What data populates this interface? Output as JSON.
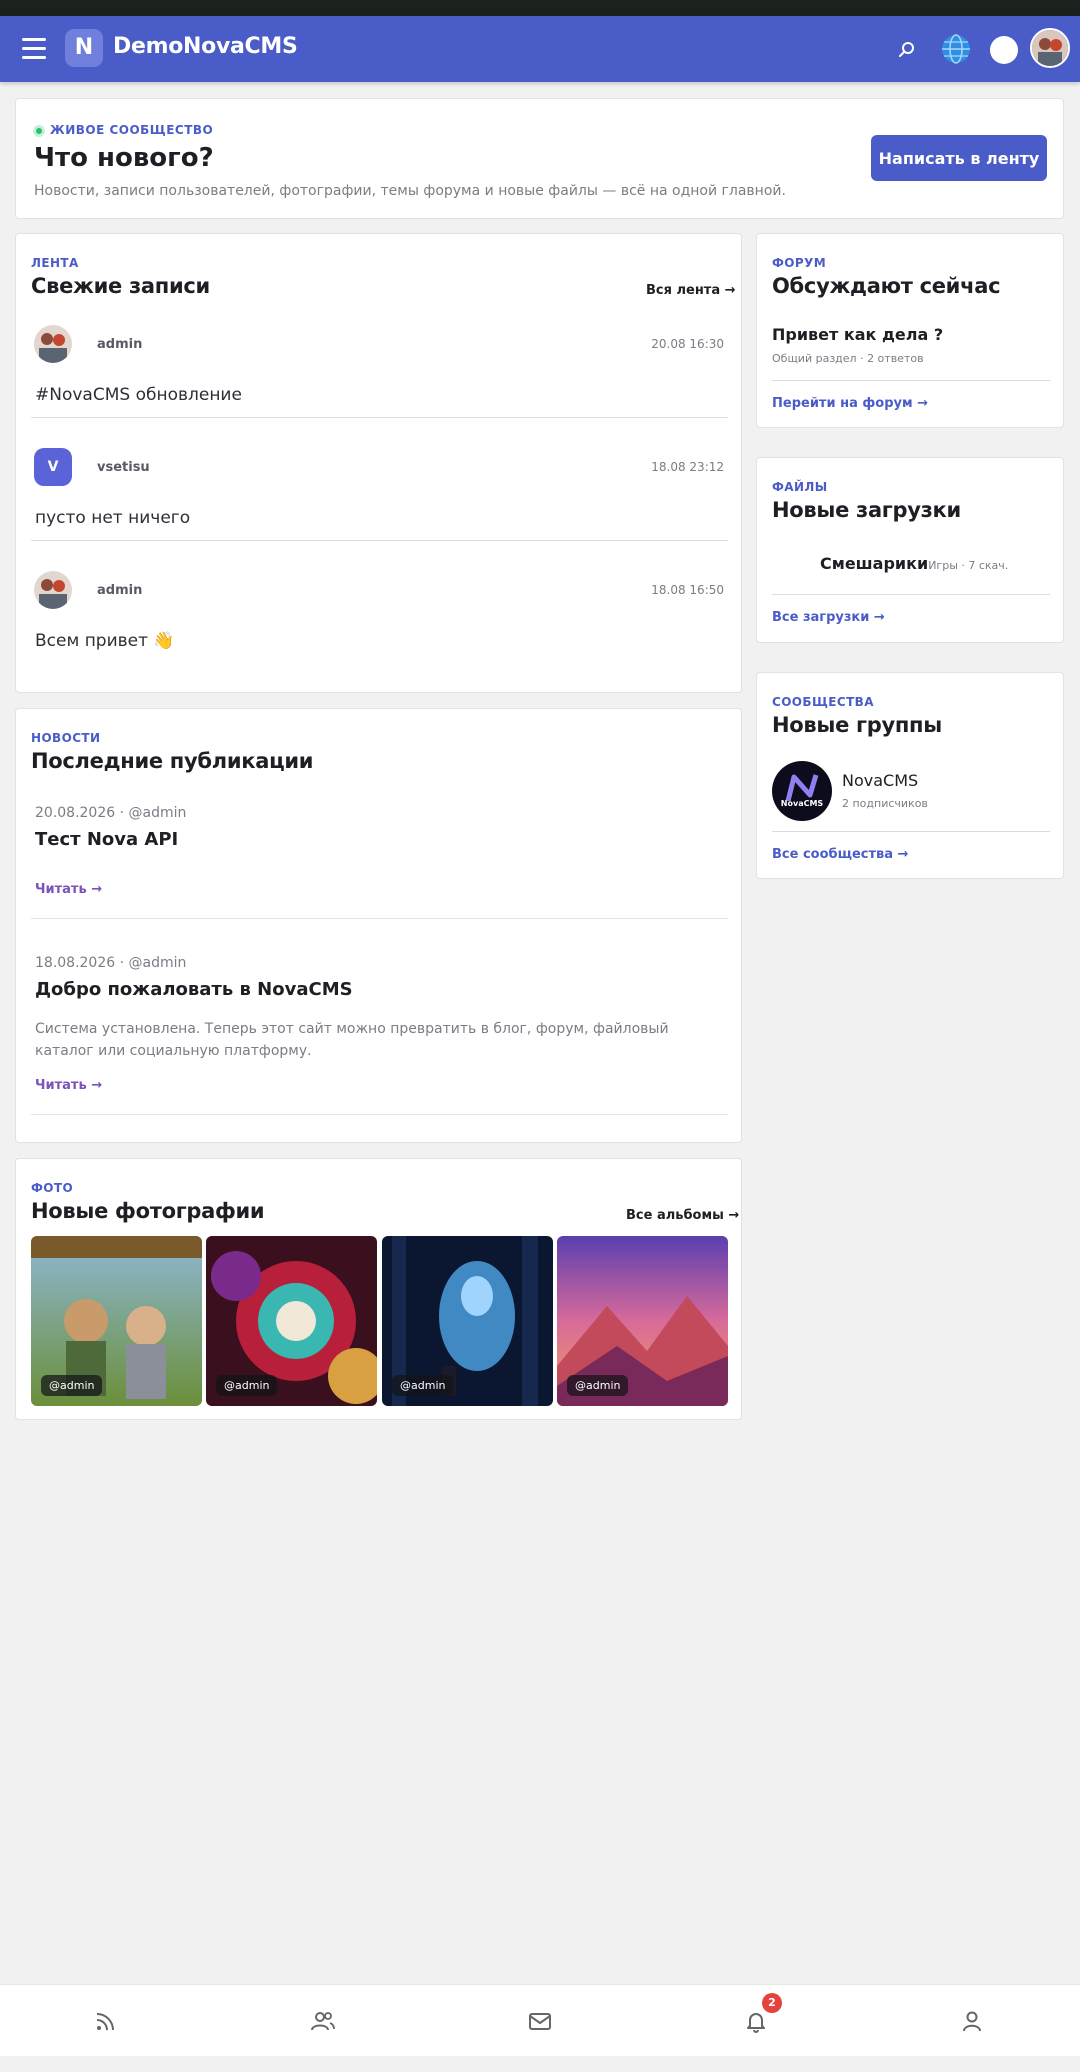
{
  "app": {
    "logo_letter": "N",
    "title": "DemoNovaCMS"
  },
  "navbar": {
    "search_icon": "search-icon",
    "globe_icon": "globe-icon",
    "theme_icon": "theme-toggle-icon",
    "accent": "#4a5cc7"
  },
  "hero": {
    "kicker": "ЖИВОЕ СООБЩЕСТВО",
    "title": "Что нового?",
    "subtitle": "Новости, записи пользователей, фотографии, темы форума и новые файлы — всё на одной главной.",
    "button": "Написать в ленту"
  },
  "feed": {
    "kicker": "ЛЕНТА",
    "title": "Свежие записи",
    "link": "Вся лента →",
    "posts": [
      {
        "user": "admin",
        "time": "20.08 16:30",
        "text": "#NovaCMS обновление",
        "avatar_letter": ""
      },
      {
        "user": "vsetisu",
        "time": "18.08 23:12",
        "text": "пусто нет ничего",
        "avatar_letter": "V"
      },
      {
        "user": "admin",
        "time": "18.08 16:50",
        "text": "Всем привет 👋",
        "avatar_letter": ""
      }
    ]
  },
  "news": {
    "kicker": "НОВОСТИ",
    "title": "Последние публикации",
    "items": [
      {
        "meta": "20.08.2026 · @admin",
        "title": "Тест Nova API",
        "desc": "",
        "read": "Читать →"
      },
      {
        "meta": "18.08.2026 · @admin",
        "title": "Добро пожаловать в NovaCMS",
        "desc": "Система установлена. Теперь этот сайт можно превратить в блог, форум, файловый каталог или социальную платформу.",
        "read": "Читать →"
      }
    ]
  },
  "photos": {
    "kicker": "ФОТО",
    "title": "Новые фотографии",
    "link": "Все альбомы →",
    "items": [
      {
        "tag": "@admin"
      },
      {
        "tag": "@admin"
      },
      {
        "tag": "@admin"
      },
      {
        "tag": "@admin"
      }
    ]
  },
  "forum": {
    "kicker": "ФОРУМ",
    "title": "Обсуждают сейчас",
    "topic": "Привет как дела ?",
    "topic_meta": "Общий раздел · 2 ответов",
    "link": "Перейти на форум →"
  },
  "files": {
    "kicker": "ФАЙЛЫ",
    "title": "Новые загрузки",
    "file_name": "Смешарики",
    "file_meta": "Игры · 7 скач.",
    "link": "Все загрузки →"
  },
  "groups": {
    "kicker": "СООБЩЕСТВА",
    "title": "Новые группы",
    "group_name": "NovaCMS",
    "group_meta": "2 подписчиков",
    "logo_text": "NovaCMS",
    "link": "Все сообщества →"
  },
  "bottombar": {
    "items": [
      "feed-icon",
      "users-icon",
      "mail-icon",
      "bell-icon",
      "profile-icon"
    ],
    "notifications_count": "2"
  }
}
